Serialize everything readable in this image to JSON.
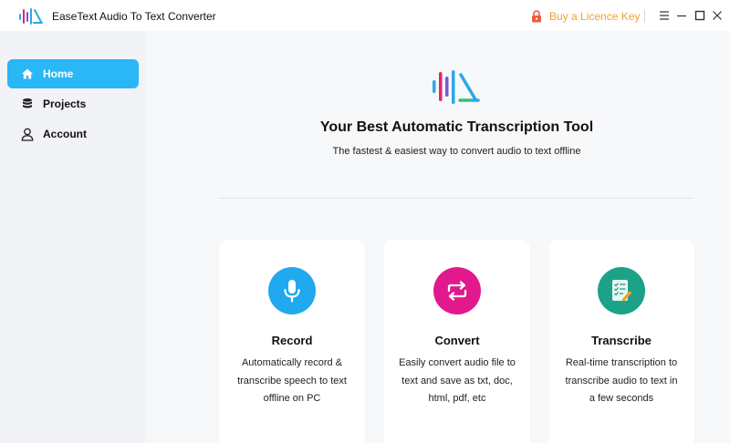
{
  "window": {
    "title": "EaseText Audio To Text Converter",
    "licence_label": "Buy a Licence Key"
  },
  "sidebar": {
    "items": [
      {
        "label": "Home",
        "icon": "home-icon",
        "active": true
      },
      {
        "label": "Projects",
        "icon": "database-icon",
        "active": false
      },
      {
        "label": "Account",
        "icon": "user-icon",
        "active": false
      }
    ]
  },
  "hero": {
    "title": "Your Best Automatic Transcription Tool",
    "subtitle": "The fastest & easiest way to convert audio to text offline"
  },
  "cards": [
    {
      "title": "Record",
      "description": "Automatically record & transcribe speech to text offline on PC",
      "icon": "microphone-icon",
      "color": "#21a9ef"
    },
    {
      "title": "Convert",
      "description": "Easily convert audio file to text and save as txt, doc, html, pdf, etc",
      "icon": "convert-arrows-icon",
      "color": "#e2198c"
    },
    {
      "title": "Transcribe",
      "description": "Real-time transcription to transcribe audio to text in a few seconds",
      "icon": "checklist-icon",
      "color": "#1ba287"
    }
  ],
  "colors": {
    "accent": "#29b7f5",
    "licence": "#f0a12a"
  }
}
